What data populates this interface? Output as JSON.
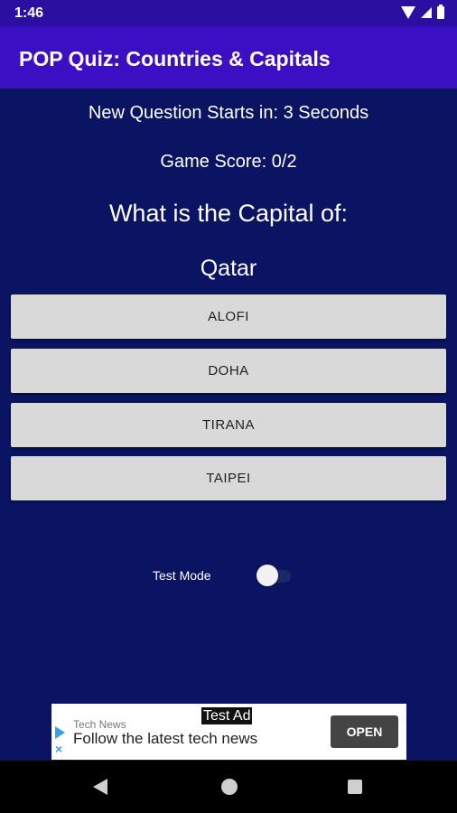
{
  "status_bar": {
    "time": "1:46",
    "icons": [
      "wifi-icon",
      "signal-icon",
      "battery-icon"
    ]
  },
  "app_bar": {
    "title": "POP Quiz: Countries & Capitals",
    "color": "#3d0fc4"
  },
  "quiz": {
    "countdown": "New Question Starts in: 3 Seconds",
    "score": "Game Score: 0/2",
    "question": "What is the Capital of:",
    "country": "Qatar",
    "answers": [
      {
        "label": "ALOFI"
      },
      {
        "label": "DOHA"
      },
      {
        "label": "TIRANA"
      },
      {
        "label": "TAIPEI"
      }
    ]
  },
  "settings": {
    "test_mode_label": "Test Mode",
    "test_mode_on": false
  },
  "ad": {
    "tag": "Test Ad",
    "source": "Tech News",
    "headline": "Follow the latest tech news",
    "cta": "OPEN"
  },
  "colors": {
    "background": "#0a1462",
    "status_bar": "#2a0fa0",
    "button": "#d9d9d9"
  }
}
